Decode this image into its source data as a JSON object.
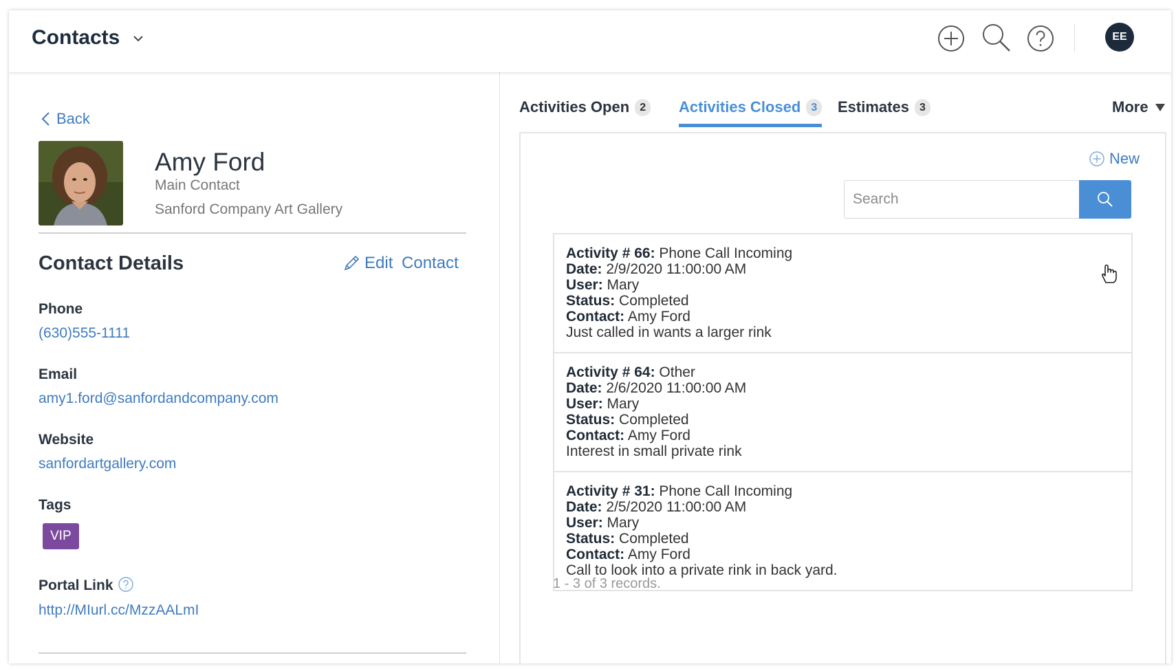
{
  "header": {
    "title": "Contacts",
    "avatar_initials": "EE"
  },
  "contact": {
    "back_label": "Back",
    "name": "Amy Ford",
    "role": "Main Contact",
    "company": "Sanford Company Art Gallery"
  },
  "details": {
    "heading": "Contact Details",
    "edit_label": "Edit Contact",
    "phone_label": "Phone",
    "phone": "(630)555-1111",
    "email_label": "Email",
    "email": "amy1.ford@sanfordandcompany.com",
    "website_label": "Website",
    "website": "sanfordartgallery.com",
    "tags_label": "Tags",
    "tags": [
      "VIP"
    ],
    "portal_label": "Portal Link",
    "portal_link": "http://MIurl.cc/MzzAALmI"
  },
  "tabs": [
    {
      "label": "Activities Open",
      "count": "2"
    },
    {
      "label": "Activities Closed",
      "count": "3"
    },
    {
      "label": "Estimates",
      "count": "3"
    },
    {
      "label": "More"
    }
  ],
  "activities_panel": {
    "new_label": "New",
    "search_placeholder": "Search",
    "records_text": "1 - 3 of 3 records."
  },
  "field_labels": {
    "date": "Date:",
    "user": "User:",
    "status": "Status:",
    "contact": "Contact:"
  },
  "activities": [
    {
      "heading": "Activity # 66:",
      "type": "Phone Call Incoming",
      "date": "2/9/2020 11:00:00 AM",
      "user": "Mary",
      "status": "Completed",
      "contact": "Amy Ford",
      "note": "Just called in wants a larger rink"
    },
    {
      "heading": "Activity # 64:",
      "type": "Other",
      "date": "2/6/2020 11:00:00 AM",
      "user": "Mary",
      "status": "Completed",
      "contact": "Amy Ford",
      "note": "Interest in small private rink"
    },
    {
      "heading": "Activity # 31:",
      "type": "Phone Call Incoming",
      "date": "2/5/2020 11:00:00 AM",
      "user": "Mary",
      "status": "Completed",
      "contact": "Amy Ford",
      "note": "Call to look into a private rink in back yard."
    }
  ],
  "colors": {
    "accent": "#4a8fd6",
    "link": "#3f7bbf",
    "tag_vip": "#7b4a9e",
    "avatar_bg": "#1c2b3c"
  }
}
